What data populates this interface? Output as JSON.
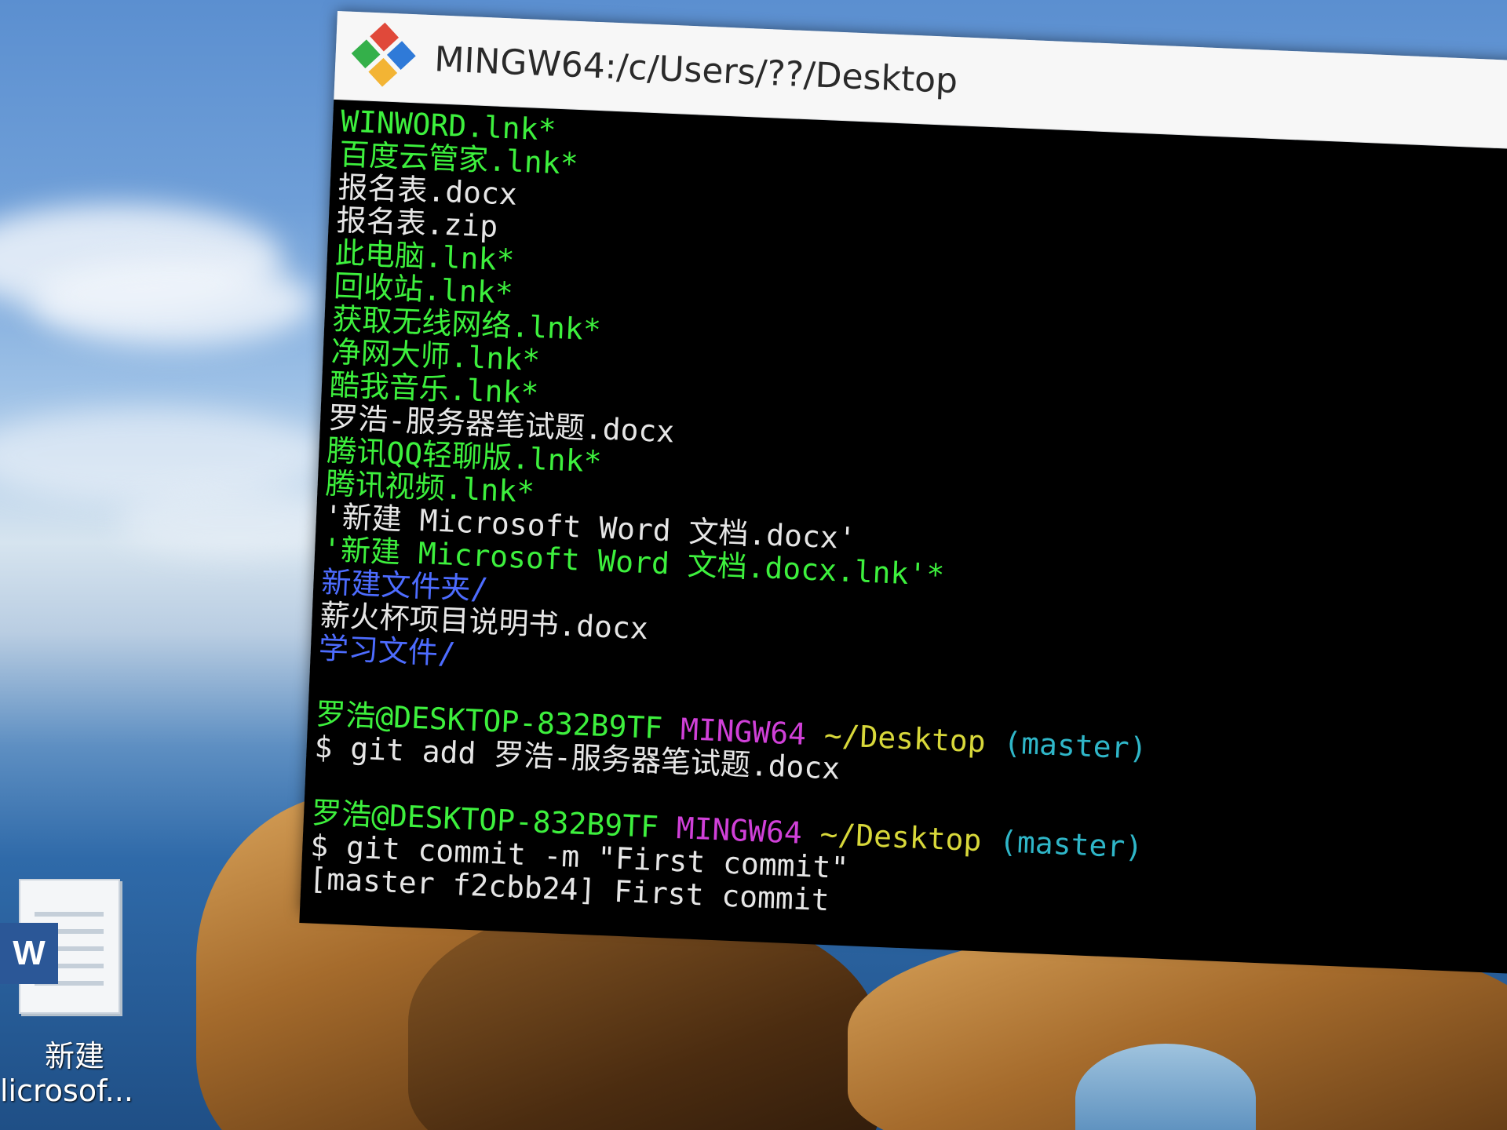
{
  "window": {
    "title": "MINGW64:/c/Users/??/Desktop",
    "icon": "git-bash-icon"
  },
  "terminal": {
    "lines": [
      {
        "text": "WINWORD.lnk*",
        "color": "green"
      },
      {
        "text": "百度云管家.lnk*",
        "color": "green"
      },
      {
        "text": "报名表.docx",
        "color": "white"
      },
      {
        "text": "报名表.zip",
        "color": "white"
      },
      {
        "text": "此电脑.lnk*",
        "color": "green"
      },
      {
        "text": "回收站.lnk*",
        "color": "green"
      },
      {
        "text": "获取无线网络.lnk*",
        "color": "green"
      },
      {
        "text": "净网大师.lnk*",
        "color": "green"
      },
      {
        "text": "酷我音乐.lnk*",
        "color": "green"
      },
      {
        "text": "罗浩-服务器笔试题.docx",
        "color": "white"
      },
      {
        "text": "腾讯QQ轻聊版.lnk*",
        "color": "green"
      },
      {
        "text": "腾讯视频.lnk*",
        "color": "green"
      },
      {
        "text": "'新建 Microsoft Word 文档.docx'",
        "color": "white"
      },
      {
        "text": "'新建 Microsoft Word 文档.docx.lnk'*",
        "color": "green"
      },
      {
        "text": "新建文件夹/",
        "color": "blue"
      },
      {
        "text": "薪火杯项目说明书.docx",
        "color": "white"
      },
      {
        "text": "学习文件/",
        "color": "blue"
      }
    ],
    "prompts": [
      {
        "user_host": "罗浩@DESKTOP-832B9TF",
        "env": "MINGW64",
        "path": "~/Desktop",
        "branch": "(master)",
        "command": "$ git add 罗浩-服务器笔试题.docx",
        "output": ""
      },
      {
        "user_host": "罗浩@DESKTOP-832B9TF",
        "env": "MINGW64",
        "path": "~/Desktop",
        "branch": "(master)",
        "command": "$ git commit -m \"First commit\"",
        "output": "[master f2cbb24] First commit"
      }
    ],
    "cursor_glyph": "I"
  },
  "desktop_icon": {
    "badge": "W",
    "label_line1": "新建",
    "label_line2": "licrosof..."
  },
  "colors": {
    "green": "#3df03d",
    "white": "#e6e6e6",
    "blue": "#4d6cff",
    "purple": "#d040d8",
    "yellow": "#d8d83a",
    "cyan": "#2fb6c8",
    "console_bg": "#000000",
    "word_blue": "#2b5797"
  }
}
